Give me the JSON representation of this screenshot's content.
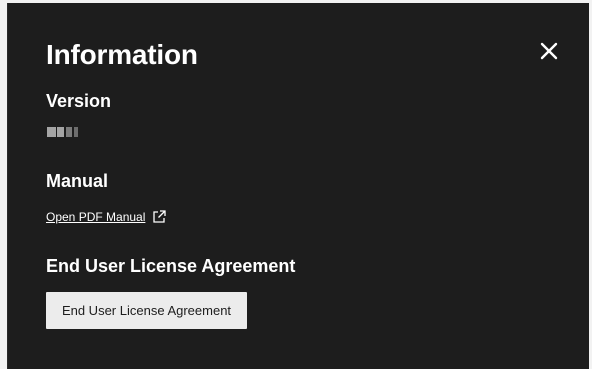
{
  "dialog": {
    "title": "Information",
    "close_icon": "close-icon"
  },
  "version": {
    "title": "Version",
    "value_redacted": true
  },
  "manual": {
    "title": "Manual",
    "link_label": "Open PDF Manual",
    "link_icon": "external-link-icon"
  },
  "eula": {
    "title": "End User License Agreement",
    "button_label": "End User License Agreement"
  },
  "colors": {
    "panel_background": "#1d1d1d",
    "text": "#ffffff",
    "button_background": "#ececec",
    "button_text": "#1d1d1d"
  }
}
